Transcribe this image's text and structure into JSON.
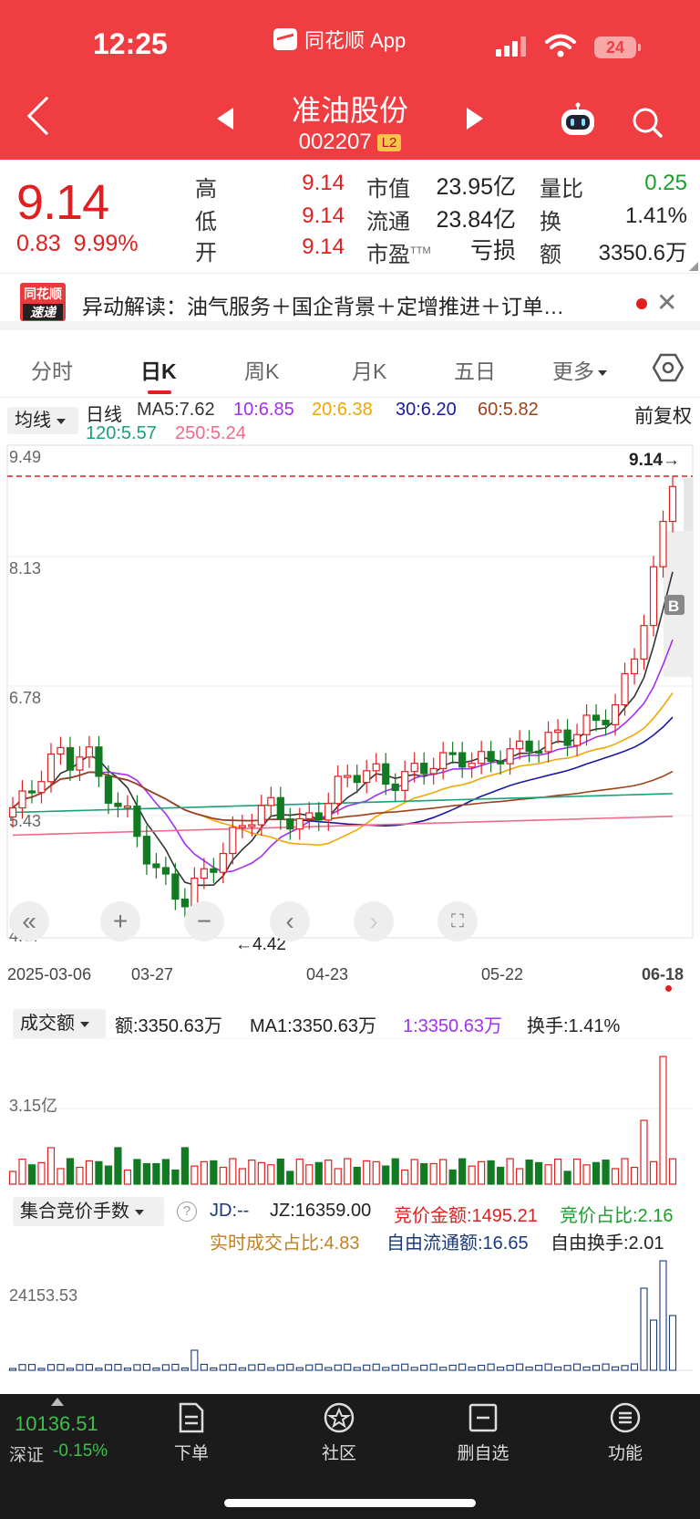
{
  "status": {
    "time": "12:25",
    "app": "同花顺 App",
    "battery": "24"
  },
  "stock": {
    "name": "准油股份",
    "code": "002207",
    "level": "L2"
  },
  "quote": {
    "price": "9.14",
    "change": "0.83",
    "change_pct": "9.99%",
    "high_label": "高",
    "high": "9.14",
    "low_label": "低",
    "low": "9.14",
    "open_label": "开",
    "open": "9.14",
    "mcap_label": "市值",
    "mcap": "23.95亿",
    "float_label": "流通",
    "float": "23.84亿",
    "pe_label": "市盈",
    "pe_sup": "TTM",
    "pe": "亏损",
    "vr_label": "量比",
    "vr": "0.25",
    "turnover_label": "换",
    "turnover": "1.41%",
    "amount_label": "额",
    "amount": "3350.6万"
  },
  "news": {
    "logo_top": "同花顺",
    "logo_bottom": "速递",
    "text": "异动解读：油气服务＋国企背景＋定增推进＋订单…"
  },
  "tabs": [
    "分时",
    "日K",
    "周K",
    "月K",
    "五日",
    "更多"
  ],
  "chart": {
    "indicator": "均线",
    "period": "日线",
    "ma5": "MA5:7.62",
    "ma10": "10:6.85",
    "ma20": "20:6.38",
    "ma30": "30:6.20",
    "ma60": "60:5.82",
    "ma120": "120:5.57",
    "ma250": "250:5.24",
    "adjust": "前复权",
    "y_labels": [
      "9.49",
      "8.13",
      "6.78",
      "5.43",
      "4.07"
    ],
    "last_price_tag": "9.14→",
    "low_tag": "←4.42",
    "buy_marker": "B",
    "dates": [
      "2025-03-06",
      "03-27",
      "04-23",
      "05-22",
      "06-18"
    ],
    "colors": {
      "ma5": "#333333",
      "ma10": "#a52ff0",
      "ma20": "#f0a800",
      "ma30": "#1a1a9e",
      "ma60": "#a0401a",
      "ma120": "#1aa07a",
      "ma250": "#f06a8a",
      "up": "#e02020",
      "down": "#127a22"
    }
  },
  "volume": {
    "indicator": "成交额",
    "amount": "额:3350.63万",
    "ma1": "MA1:3350.63万",
    "line1": "1:3350.63万",
    "turnover": "换手:1.41%",
    "y_label": "3.15亿"
  },
  "auction": {
    "indicator": "集合竞价手数",
    "jd": "JD:--",
    "jz": "JZ:16359.00",
    "auc_amount": "竞价金额:1495.21",
    "auc_ratio": "竞价占比:2.16",
    "realtime_ratio": "实时成交占比:4.83",
    "free_float": "自由流通额:16.65",
    "free_turnover": "自由换手:2.01",
    "y_label": "24153.53"
  },
  "bottom": {
    "index_value": "10136.51",
    "index_name": "深证",
    "index_change": "-0.15%",
    "nav": [
      "下单",
      "社区",
      "删自选",
      "功能"
    ]
  }
}
